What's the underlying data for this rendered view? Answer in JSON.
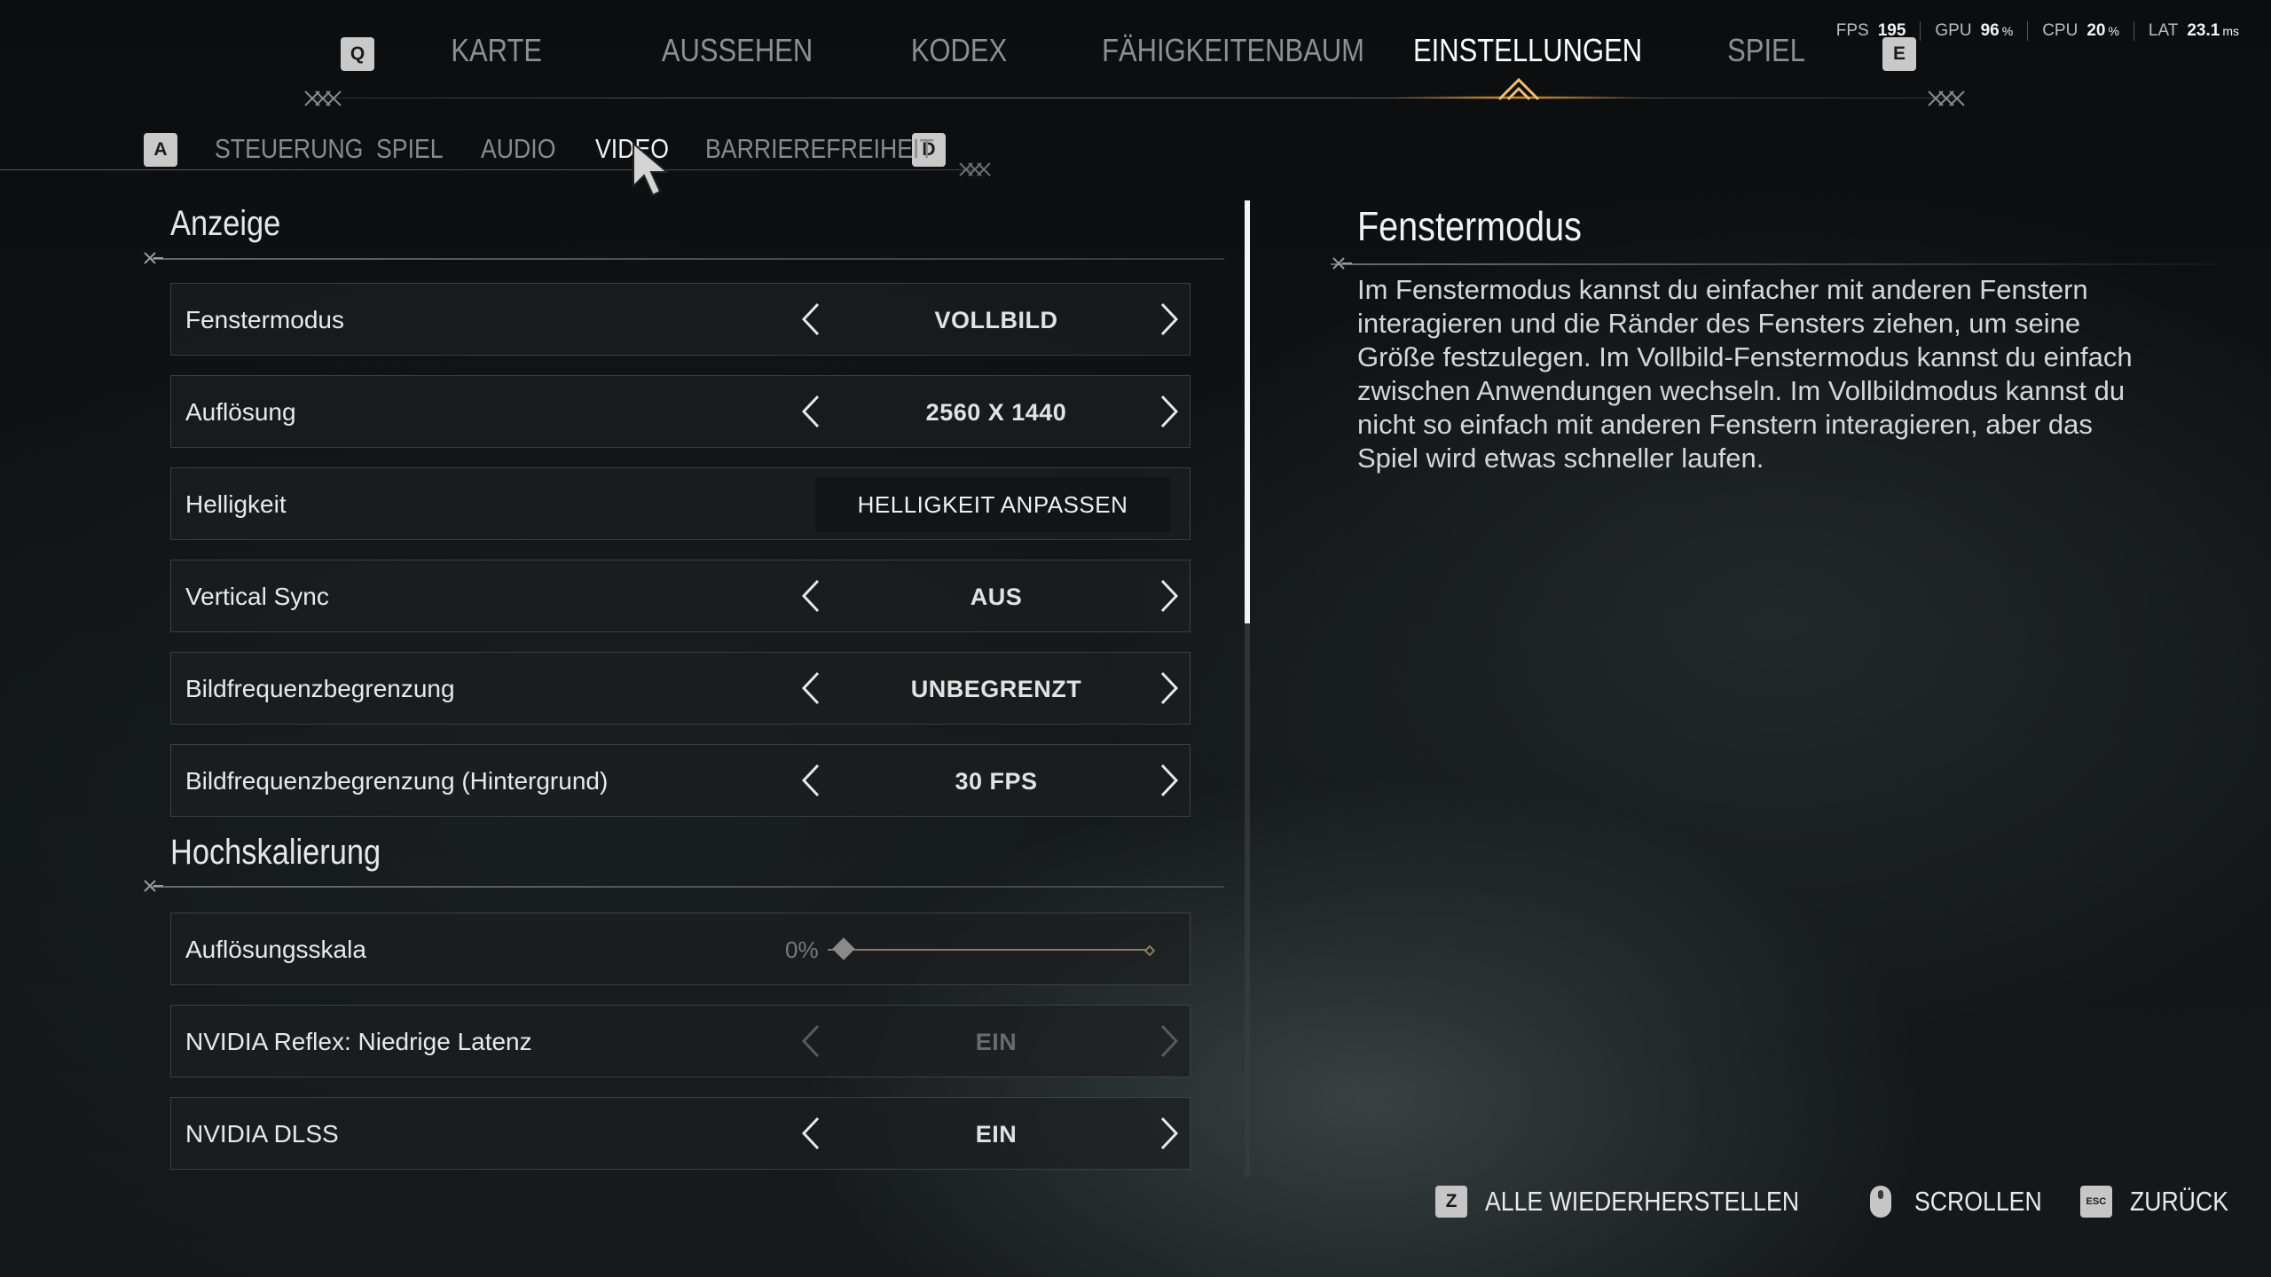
{
  "perf": [
    {
      "label": "FPS",
      "value": "195",
      "unit": ""
    },
    {
      "label": "GPU",
      "value": "96",
      "unit": "%"
    },
    {
      "label": "CPU",
      "value": "20",
      "unit": "%"
    },
    {
      "label": "LAT",
      "value": "23.1",
      "unit": "ms"
    }
  ],
  "main_nav": {
    "key_left": "Q",
    "key_right": "E",
    "tabs": [
      "KARTE",
      "AUSSEHEN",
      "KODEX",
      "FÄHIGKEITENBAUM",
      "EINSTELLUNGEN",
      "SPIEL"
    ],
    "active": "EINSTELLUNGEN"
  },
  "sub_nav": {
    "key_left": "A",
    "key_right": "D",
    "tabs": [
      "STEUERUNG",
      "SPIEL",
      "AUDIO",
      "VIDEO",
      "BARRIEREFREIHEIT"
    ],
    "active": "VIDEO"
  },
  "sections": [
    {
      "title": "Anzeige",
      "rows": [
        {
          "label": "Fenstermodus",
          "type": "selector",
          "value": "VOLLBILD"
        },
        {
          "label": "Auflösung",
          "type": "selector",
          "value": "2560 X 1440"
        },
        {
          "label": "Helligkeit",
          "type": "button",
          "value": "HELLIGKEIT ANPASSEN"
        },
        {
          "label": "Vertical Sync",
          "type": "selector",
          "value": "AUS"
        },
        {
          "label": "Bildfrequenzbegrenzung",
          "type": "selector",
          "value": "UNBEGRENZT"
        },
        {
          "label": "Bildfrequenzbegrenzung (Hintergrund)",
          "type": "selector",
          "value": "30 FPS"
        }
      ]
    },
    {
      "title": "Hochskalierung",
      "rows": [
        {
          "label": "Auflösungsskala",
          "type": "slider",
          "value": "0%",
          "level": 0
        },
        {
          "label": "NVIDIA Reflex: Niedrige Latenz",
          "type": "selector",
          "value": "EIN",
          "disabled": true
        },
        {
          "label": "NVIDIA DLSS",
          "type": "selector",
          "value": "EIN"
        }
      ]
    }
  ],
  "description": {
    "title": "Fenstermodus",
    "text": "Im Fenstermodus kannst du einfacher mit anderen Fenstern interagieren und die Ränder des Fensters ziehen, um seine Größe festzulegen. Im Vollbild-Fenstermodus kannst du einfach zwischen Anwendungen wechseln. Im Vollbildmodus kannst du nicht so einfach mit anderen Fenstern interagieren, aber das Spiel wird etwas schneller laufen."
  },
  "footer": [
    {
      "key": "Z",
      "label": "ALLE WIEDERHERSTELLEN",
      "icon": "keycap"
    },
    {
      "key": "",
      "label": "SCROLLEN",
      "icon": "mouse-icon"
    },
    {
      "key": "ESC",
      "label": "ZURÜCK",
      "icon": "keycap"
    }
  ],
  "colors": {
    "accent": "#f0a040",
    "text": "#e9e9e9",
    "muted": "#8a8a8a"
  }
}
